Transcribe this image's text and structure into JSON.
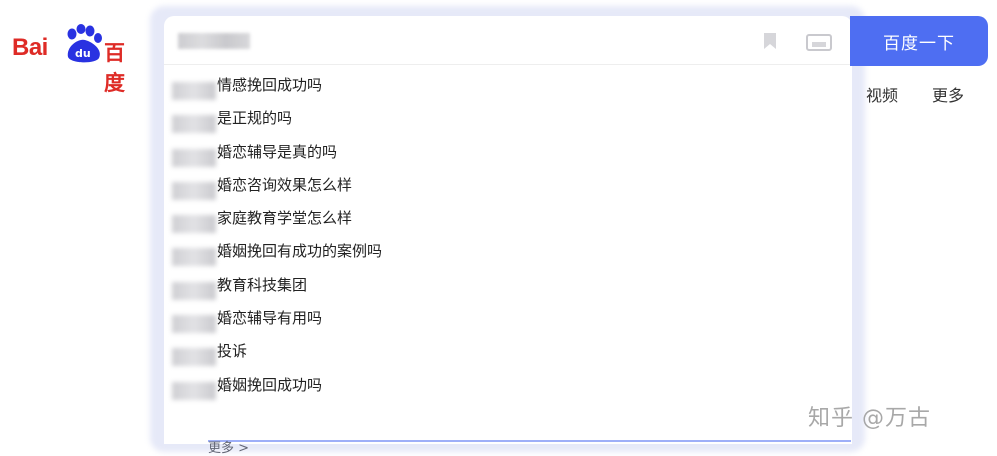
{
  "logo": {
    "text_latin": "Bai",
    "text_du": "du",
    "text_cn": "百度"
  },
  "search": {
    "value": "",
    "placeholder": "",
    "button_label": "百度一下",
    "icons": [
      "bookmark-icon",
      "camera-icon"
    ]
  },
  "suggestions": [
    "情感挽回成功吗",
    "是正规的吗",
    "婚恋辅导是真的吗",
    "婚恋咨询效果怎么样",
    "家庭教育学堂怎么样",
    "婚姻挽回有成功的案例吗",
    "教育科技集团",
    "婚恋辅导有用吗",
    "投诉",
    "婚姻挽回成功吗"
  ],
  "more_suggestions": "更多 >",
  "nav": {
    "video": "视频",
    "more": "更多"
  },
  "watermark": "知乎 @万古",
  "colors": {
    "brand_blue": "#4e6ef2",
    "logo_red": "#de2b26",
    "paw_blue": "#2932e1"
  }
}
